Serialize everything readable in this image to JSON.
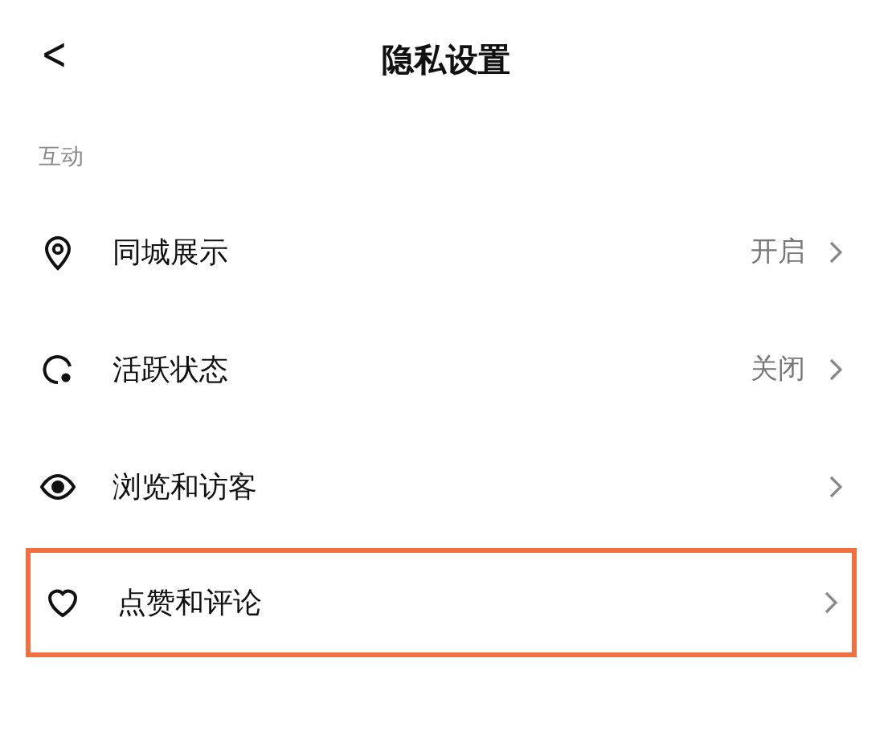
{
  "header": {
    "back": "<",
    "title": "隐私设置"
  },
  "section": {
    "label": "互动"
  },
  "rows": [
    {
      "label": "同城展示",
      "value": "开启",
      "highlighted": false
    },
    {
      "label": "活跃状态",
      "value": "关闭",
      "highlighted": false
    },
    {
      "label": "浏览和访客",
      "highlighted": false
    },
    {
      "label": "点赞和评论",
      "highlighted": true
    }
  ]
}
